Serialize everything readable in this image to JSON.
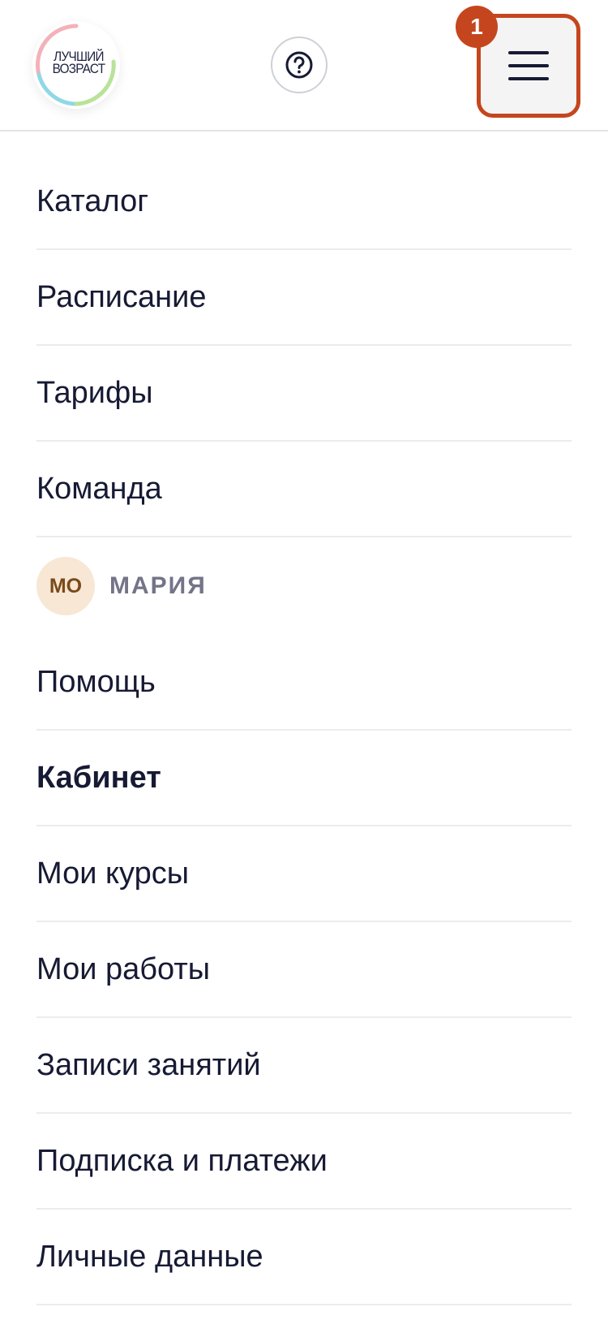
{
  "header": {
    "logo_text": [
      "ЛУЧШИЙ",
      "ВОЗРАСТ"
    ],
    "help_icon": "question-circle-icon",
    "menu_icon": "hamburger-icon",
    "badge": "1",
    "colors": {
      "accent": "#c5461e",
      "logo_ring": [
        "#f3b2b8",
        "#8fd8e6",
        "#b9e29a"
      ]
    }
  },
  "menu": {
    "items": [
      {
        "label": "Каталог"
      },
      {
        "label": "Расписание"
      },
      {
        "label": "Тарифы"
      },
      {
        "label": "Команда"
      }
    ],
    "user": {
      "initials": "МО",
      "name": "МАРИЯ"
    },
    "account_items": [
      {
        "label": "Помощь"
      },
      {
        "label": "Кабинет"
      },
      {
        "label": "Мои курсы"
      },
      {
        "label": "Мои работы"
      },
      {
        "label": "Записи занятий"
      },
      {
        "label": "Подписка и платежи"
      },
      {
        "label": "Личные данные"
      }
    ]
  }
}
